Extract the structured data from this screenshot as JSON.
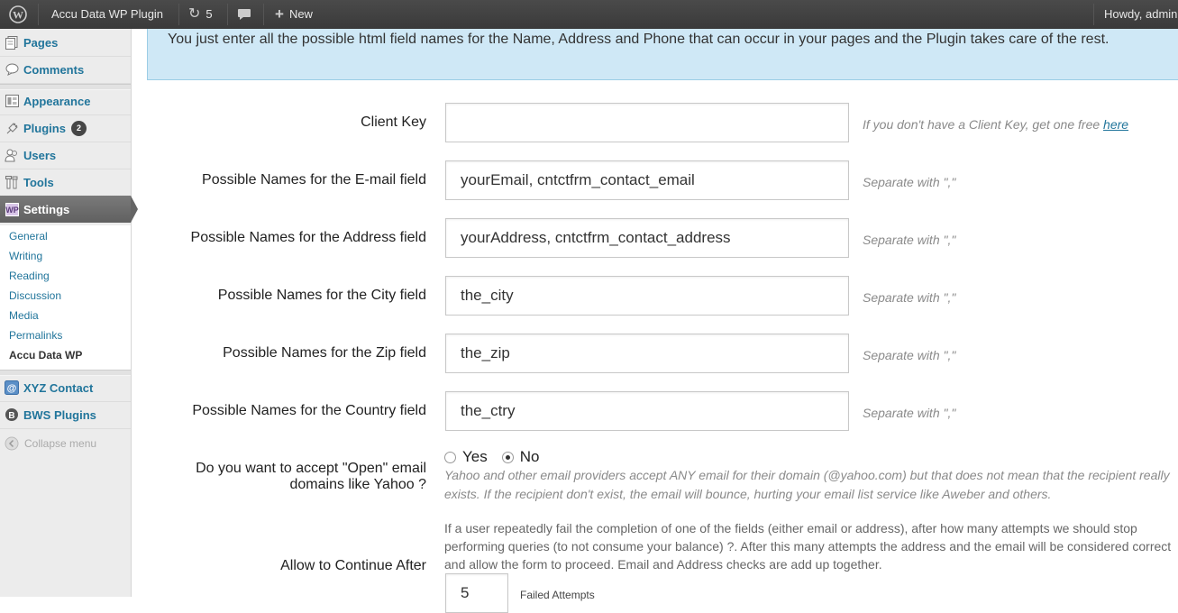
{
  "admin_bar": {
    "site_name": "Accu Data WP Plugin",
    "updates_count": "5",
    "new_label": "New",
    "howdy": "Howdy, admin"
  },
  "sidebar": {
    "menu": [
      {
        "label": "Pages",
        "icon": "pages-icon"
      },
      {
        "label": "Comments",
        "icon": "comments-icon"
      },
      {
        "label": "Appearance",
        "icon": "appearance-icon"
      },
      {
        "label": "Plugins",
        "icon": "plugins-icon",
        "badge": "2"
      },
      {
        "label": "Users",
        "icon": "users-icon"
      },
      {
        "label": "Tools",
        "icon": "tools-icon"
      },
      {
        "label": "Settings",
        "icon": "settings-icon"
      }
    ],
    "settings_submenu": [
      "General",
      "Writing",
      "Reading",
      "Discussion",
      "Media",
      "Permalinks",
      "Accu Data WP"
    ],
    "extra_menu": [
      {
        "label": "XYZ Contact",
        "icon": "contact-icon"
      },
      {
        "label": "BWS Plugins",
        "icon": "bws-icon"
      }
    ],
    "collapse_label": "Collapse menu"
  },
  "info": {
    "text": "You just enter all the possible html field names for the Name, Address and Phone that can occur in your pages and the Plugin takes care of the rest."
  },
  "form": {
    "client_key": {
      "label": "Client Key",
      "value": "",
      "hint_prefix": "If you don't have a Client Key, get one free ",
      "hint_link": "here"
    },
    "fields": [
      {
        "label": "Possible Names for the E-mail field",
        "value": "yourEmail, cntctfrm_contact_email",
        "hint": "Separate with \",\""
      },
      {
        "label": "Possible Names for the Address field",
        "value": "yourAddress, cntctfrm_contact_address",
        "hint": "Separate with \",\""
      },
      {
        "label": "Possible Names for the City field",
        "value": "the_city",
        "hint": "Separate with \",\""
      },
      {
        "label": "Possible Names for the Zip field",
        "value": "the_zip",
        "hint": "Separate with \",\""
      },
      {
        "label": "Possible Names for the Country field",
        "value": "the_ctry",
        "hint": "Separate with \",\""
      }
    ],
    "open_email": {
      "label_line1": "Do you want to accept \"Open\" email",
      "label_line2": "domains like Yahoo ?",
      "yes_label": "Yes",
      "no_label": "No",
      "selected": "No",
      "desc_line1": "Yahoo and other email providers accept ANY email for their domain (@yahoo.com) but that does not mean that the recipient really",
      "desc_line2": "exists. If the recipient don't exist, the email will bounce, hurting your email list service like Aweber and others."
    },
    "continue_after": {
      "label": "Allow to Continue After",
      "desc_line1": "If a user repeatedly fail the completion of one of the fields (either email or address), after how many attempts we should stop",
      "desc_line2": "performing queries (to not consume your balance) ?. After this many attempts the address and the email will be considered correct",
      "desc_line3": "and allow the form to proceed. Email and Address checks are add up together.",
      "value": "5",
      "suffix": "Failed Attempts"
    }
  }
}
